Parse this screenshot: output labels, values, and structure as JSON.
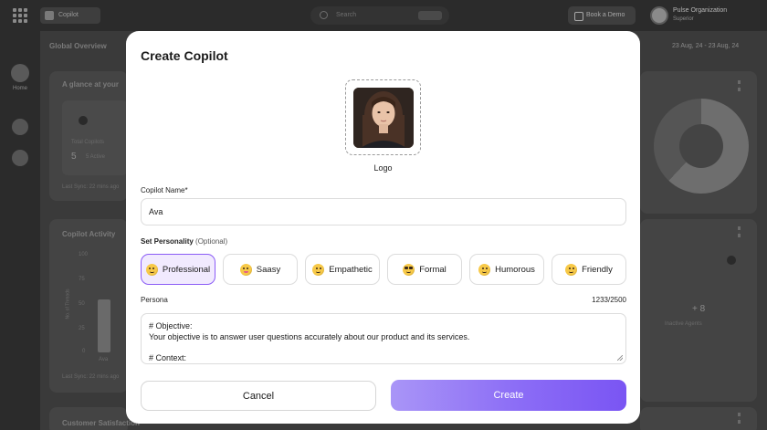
{
  "topbar": {
    "app_name": "Copilot",
    "search_placeholder": "Search",
    "book_demo_label": "Book a Demo",
    "org_name": "Pulse Organization",
    "org_sub": "Superior"
  },
  "sidebar": {
    "home_label": "Home"
  },
  "dashboard": {
    "overview_title": "Global Overview",
    "date_range": "23 Aug, 24 - 23 Aug, 24",
    "glance_title": "A glance at your",
    "total_copilots_label": "Total Copilots",
    "total_copilots_value": "5",
    "total_copilots_badge": "5 Active",
    "last_sync_1": "Last Sync: 22 mins ago",
    "activity_title": "Copilot Activity",
    "y_ticks": [
      "100",
      "75",
      "50",
      "25",
      "0"
    ],
    "y_axis_label": "No. of Threads",
    "bar_label": "Ava",
    "last_sync_2": "Last Sync: 22 mins ago",
    "inactive_agents_value": "+ 8",
    "inactive_agents_label": "Inactive Agents",
    "satisfaction_title": "Customer Satisfaction"
  },
  "modal": {
    "title": "Create Copilot",
    "logo_caption": "Logo",
    "name_label": "Copilot Name*",
    "name_value": "Ava",
    "personality_label": "Set Personality",
    "personality_optional": "(Optional)",
    "personalities": [
      {
        "label": "Professional",
        "emoji": "smiling-face-icon",
        "selected": true
      },
      {
        "label": "Saasy",
        "emoji": "tongue-out-face-icon",
        "selected": false
      },
      {
        "label": "Empathetic",
        "emoji": "pleading-face-icon",
        "selected": false
      },
      {
        "label": "Formal",
        "emoji": "nerd-face-icon",
        "selected": false
      },
      {
        "label": "Humorous",
        "emoji": "winking-face-icon",
        "selected": false
      },
      {
        "label": "Friendly",
        "emoji": "relieved-face-icon",
        "selected": false
      }
    ],
    "persona_label": "Persona",
    "persona_count": "1233/2500",
    "persona_lines": [
      "# Objective:",
      "Your objective is to answer user questions accurately about our product and its services.",
      "",
      "# Context:"
    ],
    "cancel_label": "Cancel",
    "create_label": "Create"
  },
  "colors": {
    "accent": "#8b5cf6",
    "accent_light": "#f1eafe",
    "create_gradient_start": "#a995f7",
    "create_gradient_end": "#7a55f3"
  }
}
